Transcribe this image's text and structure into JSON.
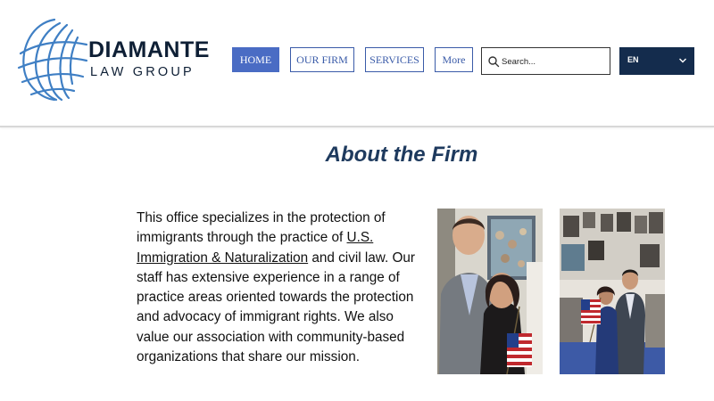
{
  "logo": {
    "title": "DIAMANTE",
    "subtitle": "LAW GROUP"
  },
  "nav": {
    "home": "HOME",
    "our_firm": "OUR FIRM",
    "services": "SERVICES",
    "more": "More"
  },
  "search": {
    "placeholder": "Search..."
  },
  "language": {
    "current": "EN"
  },
  "main": {
    "title": "About the Firm",
    "text_before_link": "This office specializes in the protection of immigrants through the practice of ",
    "link_text": "U.S. Immigration & Naturalization",
    "text_after_link": " and civil law. Our staff has extensive experience in a range of practice areas oriented towards the protection and advocacy of immigrant rights. We also value our association with community-based organizations that share our mission."
  },
  "colors": {
    "brand_navy": "#0e1f35",
    "nav_blue": "#4a6cc4",
    "title_blue": "#1e3a5e",
    "lang_bg": "#142c4d"
  },
  "icons": [
    "globe-logo-icon",
    "search-icon",
    "chevron-down-icon"
  ]
}
